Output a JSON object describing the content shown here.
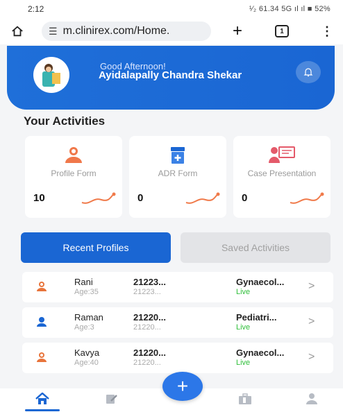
{
  "status_bar": {
    "time": "2:12",
    "indicators": "¹⁄₂ 61.34 5G ıl ıl ■ 52%"
  },
  "browser": {
    "url": "m.clinirex.com/Home.",
    "tab_count": "1",
    "icons": [
      "home-icon",
      "site-settings-icon",
      "plus-icon",
      "tabs-icon",
      "menu-icon"
    ]
  },
  "header": {
    "greeting": "Good Afternoon!",
    "user_name": "Ayidalapally Chandra Shekar",
    "accent_color": "#1a66d3"
  },
  "activities": {
    "title": "Your Activities",
    "cards": [
      {
        "label": "Profile Form",
        "count": "10",
        "icon": "doctor-icon"
      },
      {
        "label": "ADR Form",
        "count": "0",
        "icon": "medicine-box-icon"
      },
      {
        "label": "Case Presentation",
        "count": "0",
        "icon": "presentation-icon"
      }
    ]
  },
  "tabs": {
    "active": "Recent Profiles",
    "inactive": "Saved Activities"
  },
  "profiles": [
    {
      "name": "Rani",
      "age": "Age:35",
      "id": "21223...",
      "id_sub": "21223...",
      "dept": "Gynaecol...",
      "status": "Live",
      "icon_color": "#e8743b"
    },
    {
      "name": "Raman",
      "age": "Age:3",
      "id": "21220...",
      "id_sub": "21220...",
      "dept": "Pediatri...",
      "status": "Live",
      "icon_color": "#1a66d3"
    },
    {
      "name": "Kavya",
      "age": "Age:40",
      "id": "21220...",
      "id_sub": "21220...",
      "dept": "Gynaecol...",
      "status": "Live",
      "icon_color": "#e8743b"
    }
  ],
  "chevron": ">",
  "fab_label": "+",
  "bottom_nav": [
    "home-icon",
    "edit-form-icon",
    "briefcase-icon",
    "profile-icon"
  ]
}
